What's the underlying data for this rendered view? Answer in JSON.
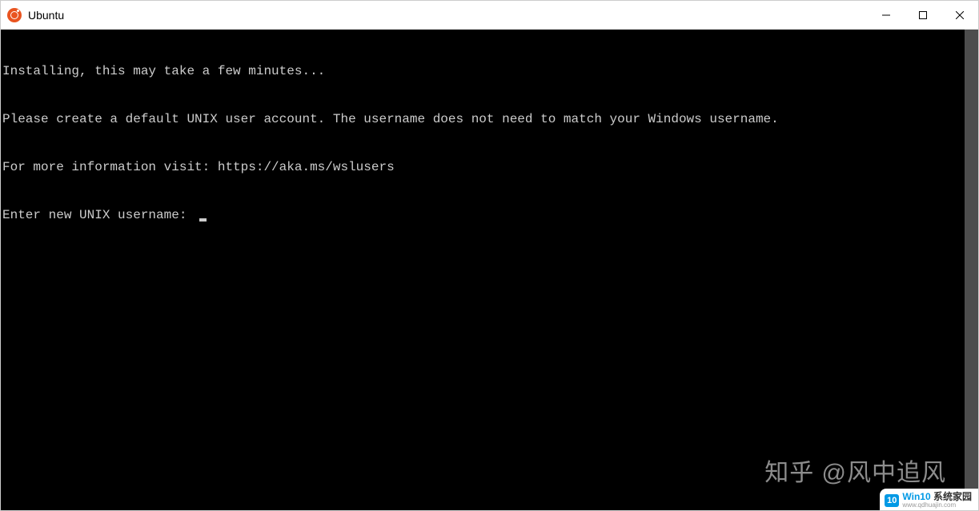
{
  "window": {
    "title": "Ubuntu"
  },
  "terminal": {
    "lines": [
      "Installing, this may take a few minutes...",
      "Please create a default UNIX user account. The username does not need to match your Windows username.",
      "For more information visit: https://aka.ms/wslusers"
    ],
    "prompt": "Enter new UNIX username: "
  },
  "watermarks": {
    "zhihu": "知乎 @风中追风",
    "badge": "10",
    "brand_en": "Win10",
    "brand_cn": " 系统家园",
    "url": "www.qdhuajin.com"
  }
}
